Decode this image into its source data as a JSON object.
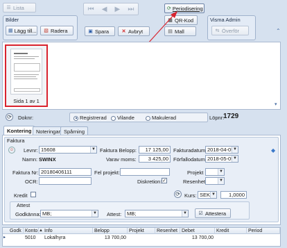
{
  "toolbar": {
    "lista_label": "Lista",
    "bilder_title": "Bilder",
    "lagg_till_label": "Lägg till...",
    "radera_label": "Radera",
    "spara_label": "Spara",
    "avbryt_label": "Avbryt",
    "periodisering_label": "Periodisering",
    "qr_label": "QR-Kod",
    "mall_label": "Mall",
    "visma_title": "Visma Admin",
    "overfor_label": "Överför"
  },
  "thumbnail": {
    "caption": "Sida 1 av 1"
  },
  "record": {
    "doknr_label": "Doknr:",
    "status_options": [
      "Registrerad",
      "Vilande",
      "Makulerad"
    ],
    "status_selected": "Registrerad",
    "lopnr_label": "Löpnr:",
    "lopnr_value": "1729"
  },
  "tabs": [
    {
      "label": "Kontering",
      "active": true
    },
    {
      "label": "Noteringar",
      "active": false
    },
    {
      "label": "Spårning",
      "active": false
    }
  ],
  "faktura": {
    "section_title": "Faktura",
    "levnr_label": "Levnr:",
    "levnr_value": "15608",
    "namn_label": "Namn:",
    "namn_value": "SWINX",
    "belopp_label": "Faktura Belopp:",
    "belopp_value": "17 125,00",
    "moms_label": "Varav moms:",
    "moms_value": "3 425,00",
    "fakturadatum_label": "Fakturadatum:",
    "fakturadatum_value": "2018-04-05",
    "forfallodatum_label": "Förfallodatum:",
    "forfallodatum_value": "2018-05-05",
    "fakturanr_label": "Faktura Nr:",
    "fakturanr_value": "20180406111",
    "fel_projekt_label": "Fel projekt:",
    "fel_projekt_value": "",
    "projekt_label": "Projekt",
    "projekt_value": "",
    "ocr_label": "OCR:",
    "ocr_value": "",
    "diskretion_label": "Diskretion:",
    "diskretion_checked": true,
    "resenhet_label": "Resenhet",
    "resenhet_value": "",
    "kredit_label": "Kredit",
    "kredit_checked": false,
    "kurs_label": "Kurs:",
    "kurs_currency": "SEK",
    "kurs_value": "1,0000"
  },
  "attest": {
    "title": "Attest",
    "godkanna_label": "Godkänna:",
    "godkanna_value": "MB;",
    "attest_label": "Attest:",
    "attest_value": "MB;",
    "attestera_label": "Attestera"
  },
  "grid": {
    "columns": [
      "Godk",
      "Konto",
      "Info",
      "Belopp",
      "Projekt",
      "Resenhet",
      "Debet",
      "Kredit",
      "Period"
    ],
    "rows": [
      {
        "godk": "",
        "konto": "5010",
        "info": "Lokalhyra",
        "belopp": "13 700,00",
        "projekt": "",
        "resenhet": "",
        "debet": "13 700,00",
        "kredit": "",
        "period": ""
      }
    ]
  },
  "colors": {
    "accent": "#1c3d73",
    "annotation_arrow": "#d9232e",
    "thumbnail_border": "#d9232e",
    "toolbar_bg": "#d6e1ef"
  }
}
